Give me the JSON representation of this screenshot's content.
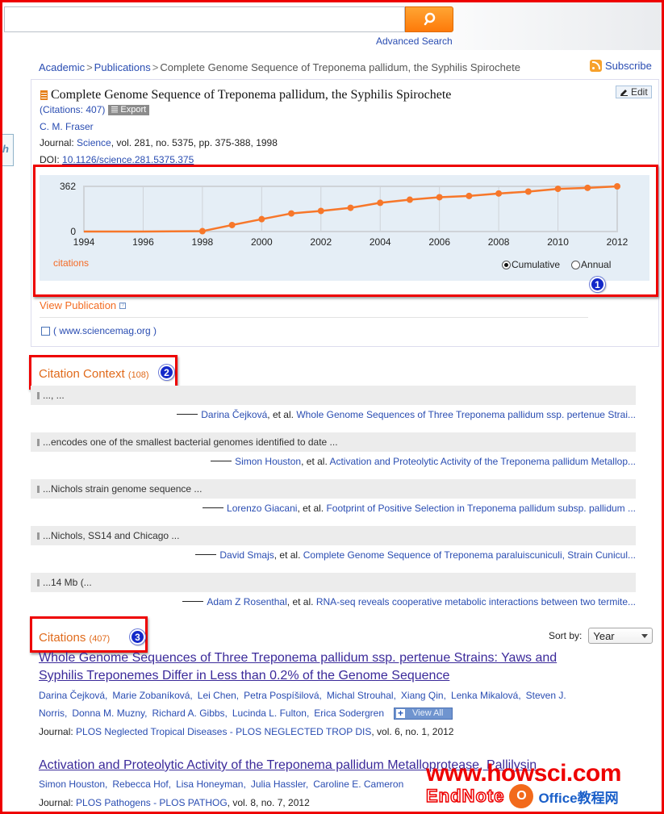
{
  "header": {
    "search_value": "",
    "search_button_icon": "search-icon",
    "advanced_search": "Advanced Search",
    "left_stub_text": "h"
  },
  "breadcrumb": {
    "items": [
      "Academic",
      "Publications"
    ],
    "current": "Complete Genome Sequence of Treponema pallidum, the Syphilis Spirochete",
    "separator": ">"
  },
  "subscribe": "Subscribe",
  "publication": {
    "title": "Complete Genome Sequence of Treponema pallidum, the Syphilis Spirochete",
    "edit": "Edit",
    "citations_label": "(Citations: 407)",
    "export": "Export",
    "author": "C. M. Fraser",
    "journal_prefix": "Journal: ",
    "journal_name": "Science",
    "journal_rest": ", vol. 281, no. 5375, pp. 375-388, 1998",
    "doi_prefix": "DOI: ",
    "doi": "10.1126/science.281.5375.375",
    "view_publication": "View Publication",
    "ext_link": "( www.sciencemag.org )"
  },
  "chart_data": {
    "type": "line",
    "title": "",
    "series_label": "citations",
    "x": [
      1994,
      1995,
      1996,
      1997,
      1998,
      1999,
      2000,
      2001,
      2002,
      2003,
      2004,
      2005,
      2006,
      2007,
      2008,
      2009,
      2010,
      2011,
      2012
    ],
    "values": [
      0,
      0,
      0,
      null,
      3,
      52,
      99,
      145,
      165,
      190,
      230,
      255,
      275,
      285,
      305,
      320,
      342,
      350,
      362
    ],
    "markers_from": 1998,
    "xticks": [
      "1994",
      "1996",
      "1998",
      "2000",
      "2002",
      "2004",
      "2006",
      "2008",
      "2010",
      "2012"
    ],
    "yticks": [
      "0",
      "362"
    ],
    "ylim": [
      0,
      362
    ],
    "xlim": [
      1994,
      2012
    ],
    "grid": true,
    "color": "#f7772a",
    "modes": [
      "Cumulative",
      "Annual"
    ],
    "selected_mode": "Cumulative"
  },
  "badges": [
    "1",
    "2",
    "3"
  ],
  "citation_context": {
    "title": "Citation Context",
    "count": "(108)",
    "items": [
      {
        "snippet": "..., ...",
        "author": "Darina Čejková",
        "etal": ", et al. ",
        "paper": "Whole Genome Sequences of Three Treponema pallidum ssp. pertenue Strai..."
      },
      {
        "snippet": "...encodes one of the smallest bacterial genomes identified to date ...",
        "author": "Simon Houston",
        "etal": ", et al. ",
        "paper": "Activation and Proteolytic Activity of the Treponema pallidum Metallop..."
      },
      {
        "snippet": "...Nichols strain genome sequence ...",
        "author": "Lorenzo Giacani",
        "etal": ", et al. ",
        "paper": "Footprint of Positive Selection in Treponema pallidum subsp. pallidum ..."
      },
      {
        "snippet": "...Nichols, SS14 and Chicago ...",
        "author": "David Smajs",
        "etal": ", et al. ",
        "paper": "Complete Genome Sequence of Treponema paraluiscuniculi, Strain Cunicul..."
      },
      {
        "snippet": "...14 Mb (...",
        "author": "Adam Z Rosenthal",
        "etal": ", et al. ",
        "paper": "RNA-seq reveals cooperative metabolic interactions between two termite..."
      }
    ]
  },
  "citations": {
    "title": "Citations",
    "count": "(407)",
    "sort_label": "Sort by:",
    "sort_value": "Year",
    "view_all": "View All",
    "items": [
      {
        "title": "Whole Genome Sequences of Three Treponema pallidum ssp. pertenue Strains: Yaws and Syphilis Treponemes Differ in Less than 0.2% of the Genome Sequence",
        "authors": [
          "Darina Čejková,",
          "Marie Zobaníková,",
          "Lei Chen,",
          "Petra Pospíšilová,",
          "Michal Strouhal,",
          "Xiang Qin,",
          "Lenka Mikalová,",
          "Steven J. Norris,",
          "Donna M. Muzny,",
          "Richard A. Gibbs,",
          "Lucinda L. Fulton,",
          "Erica Sodergren"
        ],
        "journal_prefix": "Journal: ",
        "journal_name": "PLOS Neglected Tropical Diseases - PLOS NEGLECTED TROP DIS",
        "journal_rest": ", vol. 6, no. 1, 2012"
      },
      {
        "title": "Activation and Proteolytic Activity of the Treponema pallidum Metalloprotease, Pallilysin",
        "authors": [
          "Simon Houston,",
          "Rebecca Hof,",
          "Lisa Honeyman,",
          "Julia Hassler,",
          "Caroline E. Cameron"
        ],
        "journal_prefix": "Journal: ",
        "journal_name": "PLOS Pathogens - PLOS PATHOG",
        "journal_rest": ", vol. 8, no. 7, 2012"
      }
    ]
  },
  "watermark": {
    "url": "www.howsci.com",
    "sub": "EndNote",
    "brand": "Office教程网",
    "icon": "O"
  }
}
